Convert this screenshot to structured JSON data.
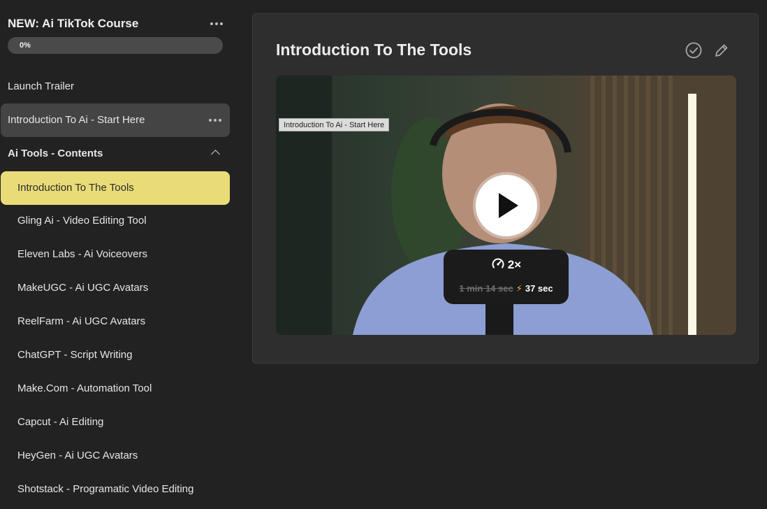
{
  "course": {
    "title": "NEW: Ai TikTok Course",
    "progress_label": "0%",
    "progress_value": 0
  },
  "sidebar": {
    "items": [
      {
        "label": "Launch Trailer"
      },
      {
        "label": "Introduction To Ai - Start Here"
      }
    ],
    "section": {
      "title": "Ai Tools - Contents",
      "lessons": [
        {
          "label": "Introduction To The Tools"
        },
        {
          "label": "Gling Ai - Video Editing Tool"
        },
        {
          "label": "Eleven Labs - Ai Voiceovers"
        },
        {
          "label": "MakeUGC - Ai UGC Avatars"
        },
        {
          "label": "ReelFarm - Ai UGC Avatars"
        },
        {
          "label": "ChatGPT - Script Writing"
        },
        {
          "label": "Make.Com - Automation Tool"
        },
        {
          "label": "Capcut - Ai Editing"
        },
        {
          "label": "HeyGen - Ai UGC Avatars"
        },
        {
          "label": "Shotstack - Programatic Video Editing"
        }
      ]
    }
  },
  "main": {
    "lesson_title": "Introduction To The Tools",
    "video": {
      "chip_label": "Introduction To Ai - Start Here",
      "speed_label": "2×",
      "original_duration": "1 min 14 sec",
      "fast_duration": "37 sec"
    }
  },
  "colors": {
    "background": "#222222",
    "active_item": "#e9dc78",
    "hover_item": "#444444",
    "bolt": "#f5b73b"
  },
  "icons": [
    "more-dots-icon",
    "chevron-up-icon",
    "check-circle-icon",
    "pencil-icon",
    "play-icon",
    "gauge-icon",
    "lightning-icon"
  ]
}
